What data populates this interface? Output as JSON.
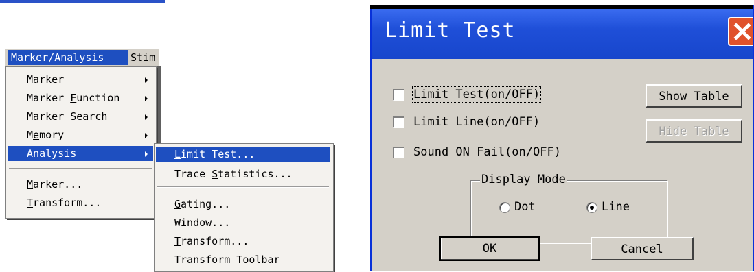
{
  "menubar": {
    "items": [
      {
        "label": "Marker/Analysis",
        "mnemonic": "M"
      },
      {
        "label": "Stim",
        "mnemonic": "S"
      }
    ]
  },
  "main_menu": {
    "items": [
      {
        "label": "Marker",
        "submenu": true
      },
      {
        "label": "Marker Function",
        "submenu": true
      },
      {
        "label": "Marker Search",
        "submenu": true
      },
      {
        "label": "Memory",
        "submenu": true
      },
      {
        "label": "Analysis",
        "submenu": true,
        "selected": true
      },
      {
        "label": "Marker...",
        "submenu": false
      },
      {
        "label": "Transform...",
        "submenu": false
      }
    ]
  },
  "submenu": {
    "items": [
      {
        "label": "Limit Test...",
        "selected": true
      },
      {
        "label": "Trace Statistics..."
      },
      {
        "label": "Gating..."
      },
      {
        "label": "Window..."
      },
      {
        "label": "Transform..."
      },
      {
        "label": "Transform Toolbar"
      }
    ]
  },
  "dialog": {
    "title": "Limit Test",
    "checkboxes": [
      {
        "label": "Limit Test(on/OFF)",
        "checked": false
      },
      {
        "label": "Limit Line(on/OFF)",
        "checked": false
      },
      {
        "label": "Sound ON Fail(on/OFF)",
        "checked": false
      }
    ],
    "show_table_label": "Show Table",
    "hide_table_label": "Hide Table",
    "display_mode": {
      "legend": "Display Mode",
      "options": [
        {
          "label": "Dot",
          "selected": false
        },
        {
          "label": "Line",
          "selected": true
        }
      ]
    },
    "ok_label": "OK",
    "cancel_label": "Cancel"
  },
  "colors": {
    "menu_highlight": "#1e4fc0",
    "titlebar": "#1f4fd8",
    "close_button": "#e0522c",
    "dialog_face": "#d4d0c8"
  }
}
